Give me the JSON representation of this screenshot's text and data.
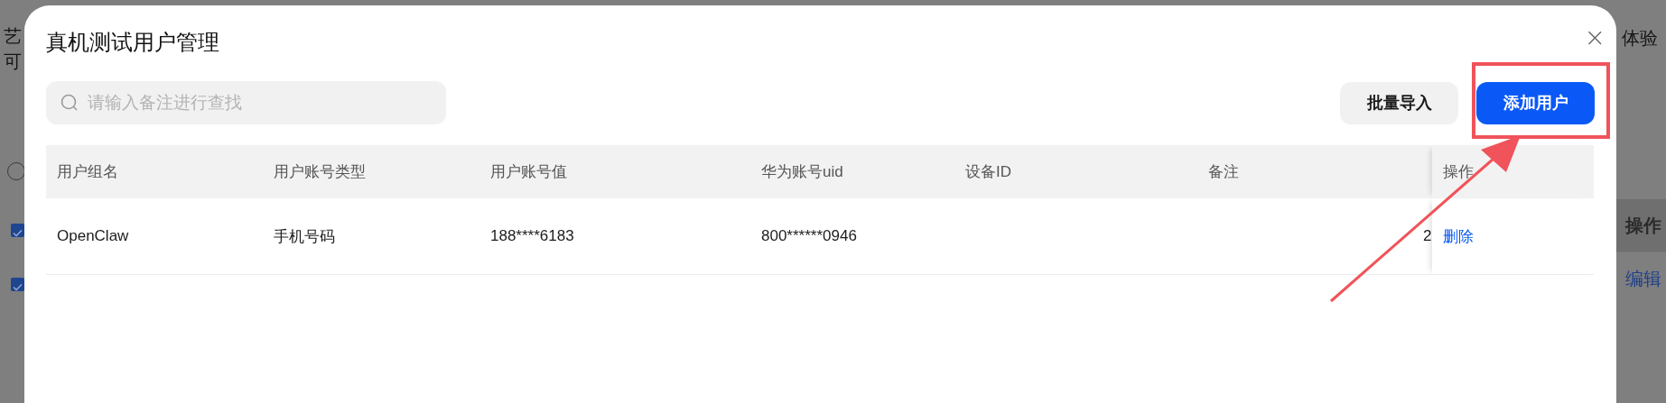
{
  "background": {
    "left_texts": [
      "艺",
      "可"
    ],
    "right_title": "体验",
    "rows": [
      {
        "checked": true,
        "cell": "操作",
        "kind": "header"
      },
      {
        "checked": true,
        "cell": "编辑",
        "kind": "link"
      }
    ]
  },
  "dialog": {
    "title": "真机测试用户管理",
    "close": "×",
    "search": {
      "placeholder": "请输入备注进行查找"
    },
    "buttons": [
      {
        "label": "批量导入",
        "kind": "secondary"
      },
      {
        "label": "添加用户",
        "kind": "primary"
      }
    ],
    "table": {
      "columns": [
        "用户组名",
        "用户账号类型",
        "用户账号值",
        "华为账号uid",
        "设备ID",
        "备注"
      ],
      "fixed_column": "操作",
      "rows": [
        {
          "cells": [
            "OpenClaw",
            "手机号码",
            "188****6183",
            "800******0946",
            null,
            null,
            "2"
          ],
          "actions": [
            "删除"
          ]
        }
      ]
    }
  }
}
